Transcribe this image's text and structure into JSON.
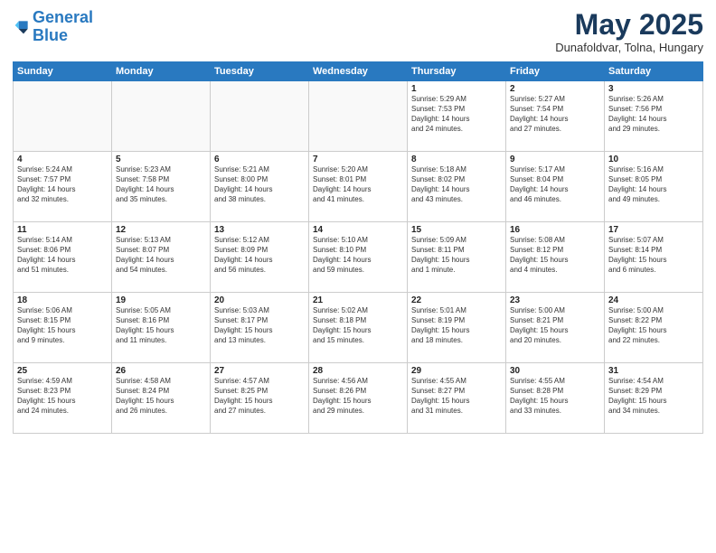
{
  "header": {
    "logo_line1": "General",
    "logo_line2": "Blue",
    "month_title": "May 2025",
    "subtitle": "Dunafoldvar, Tolna, Hungary"
  },
  "weekdays": [
    "Sunday",
    "Monday",
    "Tuesday",
    "Wednesday",
    "Thursday",
    "Friday",
    "Saturday"
  ],
  "weeks": [
    [
      {
        "day": "",
        "info": ""
      },
      {
        "day": "",
        "info": ""
      },
      {
        "day": "",
        "info": ""
      },
      {
        "day": "",
        "info": ""
      },
      {
        "day": "1",
        "info": "Sunrise: 5:29 AM\nSunset: 7:53 PM\nDaylight: 14 hours\nand 24 minutes."
      },
      {
        "day": "2",
        "info": "Sunrise: 5:27 AM\nSunset: 7:54 PM\nDaylight: 14 hours\nand 27 minutes."
      },
      {
        "day": "3",
        "info": "Sunrise: 5:26 AM\nSunset: 7:56 PM\nDaylight: 14 hours\nand 29 minutes."
      }
    ],
    [
      {
        "day": "4",
        "info": "Sunrise: 5:24 AM\nSunset: 7:57 PM\nDaylight: 14 hours\nand 32 minutes."
      },
      {
        "day": "5",
        "info": "Sunrise: 5:23 AM\nSunset: 7:58 PM\nDaylight: 14 hours\nand 35 minutes."
      },
      {
        "day": "6",
        "info": "Sunrise: 5:21 AM\nSunset: 8:00 PM\nDaylight: 14 hours\nand 38 minutes."
      },
      {
        "day": "7",
        "info": "Sunrise: 5:20 AM\nSunset: 8:01 PM\nDaylight: 14 hours\nand 41 minutes."
      },
      {
        "day": "8",
        "info": "Sunrise: 5:18 AM\nSunset: 8:02 PM\nDaylight: 14 hours\nand 43 minutes."
      },
      {
        "day": "9",
        "info": "Sunrise: 5:17 AM\nSunset: 8:04 PM\nDaylight: 14 hours\nand 46 minutes."
      },
      {
        "day": "10",
        "info": "Sunrise: 5:16 AM\nSunset: 8:05 PM\nDaylight: 14 hours\nand 49 minutes."
      }
    ],
    [
      {
        "day": "11",
        "info": "Sunrise: 5:14 AM\nSunset: 8:06 PM\nDaylight: 14 hours\nand 51 minutes."
      },
      {
        "day": "12",
        "info": "Sunrise: 5:13 AM\nSunset: 8:07 PM\nDaylight: 14 hours\nand 54 minutes."
      },
      {
        "day": "13",
        "info": "Sunrise: 5:12 AM\nSunset: 8:09 PM\nDaylight: 14 hours\nand 56 minutes."
      },
      {
        "day": "14",
        "info": "Sunrise: 5:10 AM\nSunset: 8:10 PM\nDaylight: 14 hours\nand 59 minutes."
      },
      {
        "day": "15",
        "info": "Sunrise: 5:09 AM\nSunset: 8:11 PM\nDaylight: 15 hours\nand 1 minute."
      },
      {
        "day": "16",
        "info": "Sunrise: 5:08 AM\nSunset: 8:12 PM\nDaylight: 15 hours\nand 4 minutes."
      },
      {
        "day": "17",
        "info": "Sunrise: 5:07 AM\nSunset: 8:14 PM\nDaylight: 15 hours\nand 6 minutes."
      }
    ],
    [
      {
        "day": "18",
        "info": "Sunrise: 5:06 AM\nSunset: 8:15 PM\nDaylight: 15 hours\nand 9 minutes."
      },
      {
        "day": "19",
        "info": "Sunrise: 5:05 AM\nSunset: 8:16 PM\nDaylight: 15 hours\nand 11 minutes."
      },
      {
        "day": "20",
        "info": "Sunrise: 5:03 AM\nSunset: 8:17 PM\nDaylight: 15 hours\nand 13 minutes."
      },
      {
        "day": "21",
        "info": "Sunrise: 5:02 AM\nSunset: 8:18 PM\nDaylight: 15 hours\nand 15 minutes."
      },
      {
        "day": "22",
        "info": "Sunrise: 5:01 AM\nSunset: 8:19 PM\nDaylight: 15 hours\nand 18 minutes."
      },
      {
        "day": "23",
        "info": "Sunrise: 5:00 AM\nSunset: 8:21 PM\nDaylight: 15 hours\nand 20 minutes."
      },
      {
        "day": "24",
        "info": "Sunrise: 5:00 AM\nSunset: 8:22 PM\nDaylight: 15 hours\nand 22 minutes."
      }
    ],
    [
      {
        "day": "25",
        "info": "Sunrise: 4:59 AM\nSunset: 8:23 PM\nDaylight: 15 hours\nand 24 minutes."
      },
      {
        "day": "26",
        "info": "Sunrise: 4:58 AM\nSunset: 8:24 PM\nDaylight: 15 hours\nand 26 minutes."
      },
      {
        "day": "27",
        "info": "Sunrise: 4:57 AM\nSunset: 8:25 PM\nDaylight: 15 hours\nand 27 minutes."
      },
      {
        "day": "28",
        "info": "Sunrise: 4:56 AM\nSunset: 8:26 PM\nDaylight: 15 hours\nand 29 minutes."
      },
      {
        "day": "29",
        "info": "Sunrise: 4:55 AM\nSunset: 8:27 PM\nDaylight: 15 hours\nand 31 minutes."
      },
      {
        "day": "30",
        "info": "Sunrise: 4:55 AM\nSunset: 8:28 PM\nDaylight: 15 hours\nand 33 minutes."
      },
      {
        "day": "31",
        "info": "Sunrise: 4:54 AM\nSunset: 8:29 PM\nDaylight: 15 hours\nand 34 minutes."
      }
    ]
  ]
}
